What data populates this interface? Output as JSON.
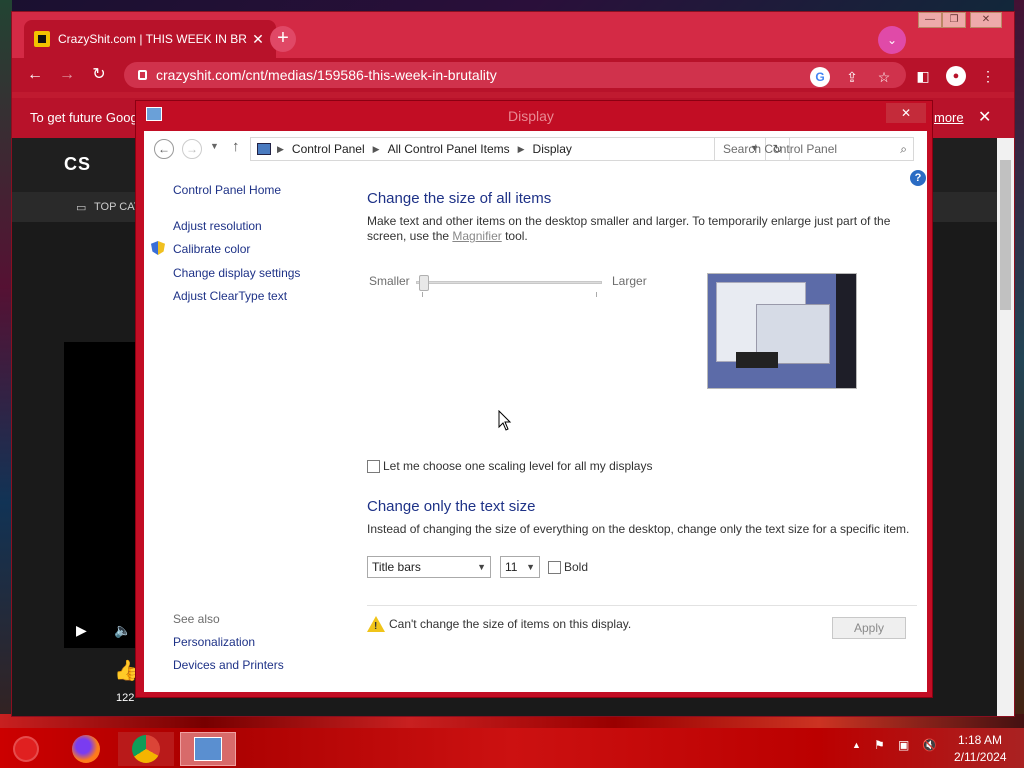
{
  "browser": {
    "tab_title": "CrazyShit.com | THIS WEEK IN BR",
    "tab_close": "✕",
    "new_tab": "+",
    "url": "crazyshit.com/cnt/medias/159586-this-week-in-brutality",
    "infobar_text": "To get future Goog",
    "infobar_more": "more",
    "infobar_close": "✕",
    "site_logo": "CS",
    "site_nav_label": "TOP CAT",
    "likes": "122"
  },
  "window": {
    "title": "Display",
    "close": "✕"
  },
  "address": {
    "crumbs": [
      "Control Panel",
      "All Control Panel Items",
      "Display"
    ]
  },
  "search": {
    "placeholder": "Search Control Panel"
  },
  "sidebar": {
    "home": "Control Panel Home",
    "items": [
      "Adjust resolution",
      "Calibrate color",
      "Change display settings",
      "Adjust ClearType text"
    ],
    "see_also_label": "See also",
    "see_also": [
      "Personalization",
      "Devices and Printers"
    ]
  },
  "main": {
    "heading1": "Change the size of all items",
    "desc1_a": "Make text and other items on the desktop smaller and larger. To temporarily enlarge just part of the",
    "desc1_b": "screen, use the ",
    "magnifier": "Magnifier",
    "desc1_c": " tool.",
    "slider_min": "Smaller",
    "slider_max": "Larger",
    "slider_value": 0,
    "checkbox_label": "Let me choose one scaling level for all my displays",
    "heading2": "Change only the text size",
    "desc2": "Instead of changing the size of everything on the desktop, change only the text size for a specific item.",
    "item_select": "Title bars",
    "size_select": "11",
    "bold_label": "Bold",
    "warning": "Can't change the size of items on this display.",
    "apply": "Apply"
  },
  "taskbar": {
    "time": "1:18 AM",
    "date": "2/11/2024"
  },
  "colors": {
    "chrome_accent": "#c01a30",
    "link": "#1e3287",
    "taskbar": "#c00000"
  }
}
